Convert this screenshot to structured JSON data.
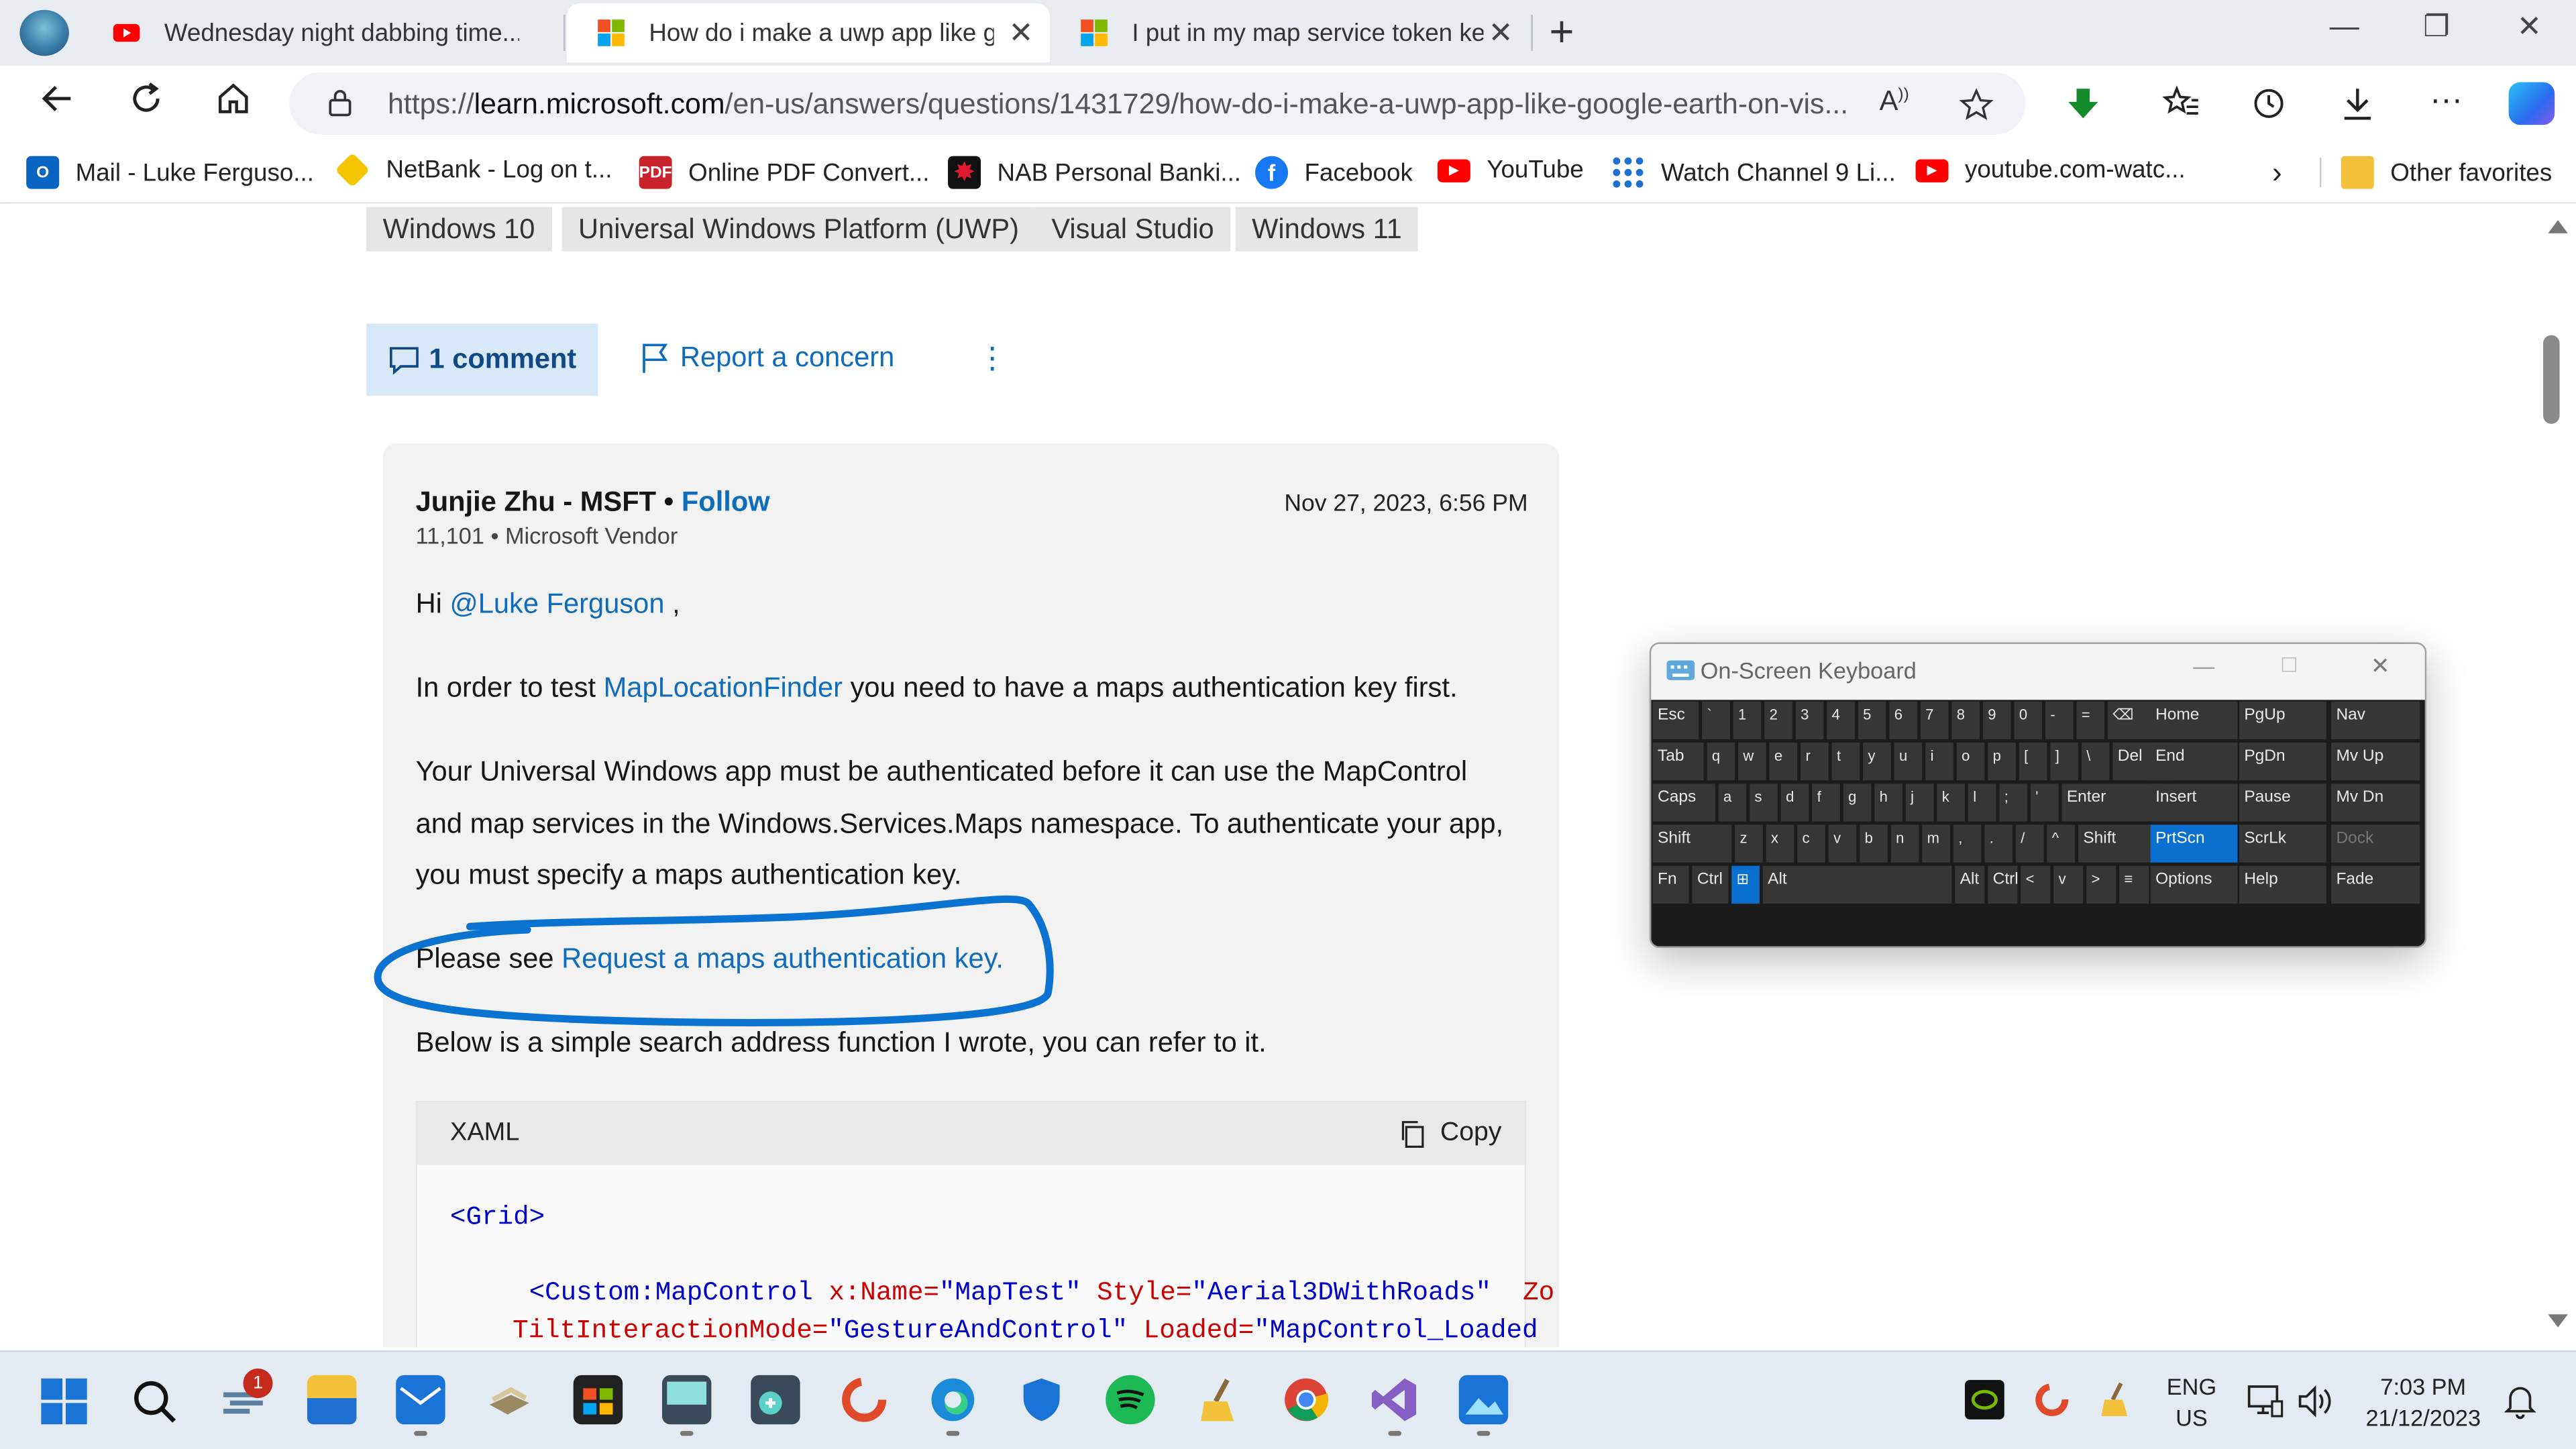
{
  "browser": {
    "tabs": [
      {
        "title": "Wednesday night dabbing time...",
        "icon": "youtube-icon"
      },
      {
        "title": "How do i make a uwp app like go",
        "icon": "microsoft-icon",
        "active": true
      },
      {
        "title": "I put in my map service token ke",
        "icon": "microsoft-icon"
      }
    ],
    "url_scheme": "https://",
    "url_host": "learn.microsoft.com",
    "url_path": "/en-us/answers/questions/1431729/how-do-i-make-a-uwp-app-like-google-earth-on-vis...",
    "favorites": [
      {
        "label": "Mail - Luke Ferguso...",
        "icon": "outlook-icon",
        "color": "#0a64c2"
      },
      {
        "label": "NetBank - Log on t...",
        "icon": "commbank-icon",
        "color": "#f5c400"
      },
      {
        "label": "Online PDF Convert...",
        "icon": "pdf-icon",
        "color": "#c8232c",
        "glyph": "PDF"
      },
      {
        "label": "NAB Personal Banki...",
        "icon": "nab-icon",
        "color": "#c8102e"
      },
      {
        "label": "Facebook",
        "icon": "facebook-icon",
        "color": "#1877f2"
      },
      {
        "label": "YouTube",
        "icon": "youtube-icon",
        "color": "#ff0000"
      },
      {
        "label": "Watch Channel 9 Li...",
        "icon": "channel9-icon",
        "color": "#1f6fd0"
      },
      {
        "label": "youtube.com-watc...",
        "icon": "youtube-icon",
        "color": "#ff0000"
      }
    ],
    "other_favorites": "Other favorites"
  },
  "page": {
    "tags": [
      "Windows 10",
      "Universal Windows Platform (UWP)",
      "Visual Studio",
      "Windows 11"
    ],
    "comment_button": "1 comment",
    "report_link": "Report a concern",
    "more_glyph": "⋮",
    "answer": {
      "author": "Junjie Zhu - MSFT",
      "follow": "Follow",
      "reputation": "11,101 • Microsoft Vendor",
      "date": "Nov 27, 2023, 6:56 PM",
      "greeting_prefix": "Hi ",
      "greeting_mention": "@Luke Ferguson",
      "greeting_suffix": " ,",
      "p1_prefix": "In order to test ",
      "p1_link": "MapLocationFinder",
      "p1_suffix": " you need to have a maps authentication key first.",
      "p2": "Your Universal Windows app must be authenticated before it can use the MapControl and map services in the Windows.Services.Maps namespace. To authenticate your app, you must specify a maps authentication key.",
      "p3_prefix": "Please see ",
      "p3_link": "Request a maps authentication key.",
      "p4": "Below is a simple search address function I wrote, you can refer to it."
    },
    "code": {
      "language": "XAML",
      "copy": "Copy",
      "line1": "<Grid>",
      "line2_tag": "<Custom:MapControl ",
      "line2_a1": "x:Name=",
      "line2_v1": "\"MapTest\"",
      "line2_a2": " Style=",
      "line2_v2": "\"Aerial3DWithRoads\"",
      "line2_tail": "  Zo",
      "line3_a1": "TiltInteractionMode=",
      "line3_v1": "\"GestureAndControl\"",
      "line3_a2": " Loaded=",
      "line3_v2": "\"MapControl_Loaded"
    }
  },
  "osk": {
    "title": "On-Screen Keyboard",
    "rows": [
      [
        "Esc",
        "`",
        "1",
        "2",
        "3",
        "4",
        "5",
        "6",
        "7",
        "8",
        "9",
        "0",
        "-",
        "=",
        "⌫",
        "Home",
        "PgUp",
        "Nav"
      ],
      [
        "Tab",
        "q",
        "w",
        "e",
        "r",
        "t",
        "y",
        "u",
        "i",
        "o",
        "p",
        "[",
        "]",
        "\\",
        "Del",
        "End",
        "PgDn",
        "Mv Up"
      ],
      [
        "Caps",
        "a",
        "s",
        "d",
        "f",
        "g",
        "h",
        "j",
        "k",
        "l",
        ";",
        "'",
        "Enter",
        "Insert",
        "Pause",
        "Mv Dn"
      ],
      [
        "Shift",
        "z",
        "x",
        "c",
        "v",
        "b",
        "n",
        "m",
        ",",
        ".",
        "/",
        "^",
        "Shift",
        "PrtScn",
        "ScrLk",
        "Dock"
      ],
      [
        "Fn",
        "Ctrl",
        "⊞",
        "Alt",
        "Alt",
        "Ctrl",
        "<",
        "v",
        ">",
        "≡",
        "Options",
        "Help",
        "Fade"
      ]
    ],
    "highlighted": [
      "PrtScn",
      "⊞"
    ]
  },
  "taskbar": {
    "notification_badge": "1",
    "lang_line1": "ENG",
    "lang_line2": "US",
    "time": "7:03 PM",
    "date": "21/12/2023"
  }
}
